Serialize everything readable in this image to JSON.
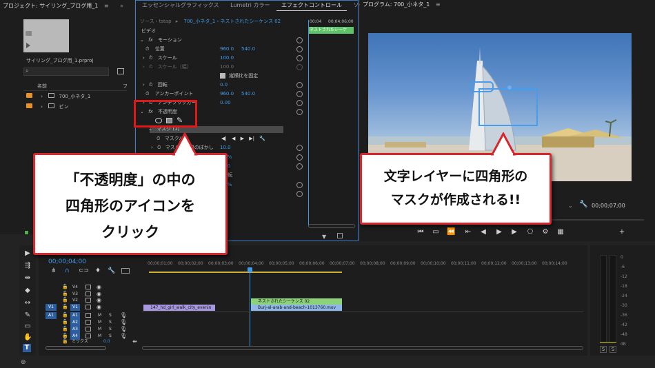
{
  "project_panel": {
    "title": "プロジェクト: サイリング_ブログ用_1",
    "filename": "サイリング_ブログ用_1.prproj",
    "col_name": "名前",
    "col_frame": "フ",
    "items": [
      {
        "label": "700_小ネタ_1"
      },
      {
        "label": "ビン"
      }
    ]
  },
  "effect_panel": {
    "tabs": [
      "エッセンシャルグラフィックス",
      "Lumetri カラー",
      "エフェクトコントロール",
      "ソー"
    ],
    "source": "ソース・tstap",
    "sequence": "700_小ネタ_1・ネストされたシーケンス 02",
    "ruler_left": "00:04",
    "ruler_right": "00;04;06;00",
    "clip_label": "ネストされたシーケ",
    "section_video": "ビデオ",
    "motion": "モーション",
    "position": {
      "label": "位置",
      "x": "960.0",
      "y": "540.0"
    },
    "scale": {
      "label": "スケール",
      "value": "100.0"
    },
    "scale_width": {
      "label": "スケール（幅）",
      "value": "100.0"
    },
    "uniform_scale": "縦横比を固定",
    "rotation": {
      "label": "回転",
      "value": "0.0"
    },
    "anchor": {
      "label": "アンカーポイント",
      "x": "960.0",
      "y": "540.0"
    },
    "antiflicker": {
      "label": "アンチフリッカー",
      "value": "0.00"
    },
    "opacity": "不透明度",
    "mask": "マスク (1)",
    "mask_path": "マスクパス",
    "mask_feather": {
      "label": "マスクの境界のぼかし",
      "value": "10.0"
    },
    "mask_opacity_value": "0 %",
    "mask_expansion_value": "0.0",
    "invert": "反転",
    "opacity_value": "0 %",
    "blend": "常"
  },
  "program_panel": {
    "title": "プログラム: 700_小ネタ_1",
    "timecode": "00;00;07;00"
  },
  "timeline": {
    "timecode": "00;00;04;00",
    "ruler": [
      "00;00;01;00",
      "00;00;02;00",
      "00;00;03;00",
      "00;00;04;00",
      "00;00;05;00",
      "00;00;06;00",
      "00;00;07;00",
      "00;00;08;00",
      "00;00;09;00",
      "00;00;10;00",
      "00;00;11;00",
      "00;00;12;00",
      "00;00;13;00",
      "00;00;14;00"
    ],
    "tracks_video": [
      "V4",
      "V3",
      "V2",
      "V1"
    ],
    "tracks_audio": [
      "A1",
      "A2",
      "A3",
      "A4"
    ],
    "src_v": "V1",
    "src_a": "A1",
    "mix_label": "ミックス",
    "mix_value": "0.0",
    "clip_nested": "ネストされたシーケンス 02",
    "clip_girl": "147_hd_girl_walk_city_evenin",
    "clip_burj": "Burj-al-arab-and-beach-1013760.mov",
    "m_label": "M",
    "s_label": "S"
  },
  "meter": {
    "labels": [
      "0",
      "-6",
      "-12",
      "-18",
      "-24",
      "-30",
      "-36",
      "-42",
      "-48",
      "dB"
    ],
    "solo": "S"
  },
  "callouts": {
    "left": [
      "「不透明度」の中の",
      "四角形のアイコンを",
      "クリック"
    ],
    "right": [
      "文字レイヤーに四角形の",
      "マスクが作成される!!"
    ]
  },
  "colors": {
    "accent_blue": "#3f9ae5",
    "callout_red": "#d7262c",
    "clip_green": "#8cd27a",
    "clip_purple": "#a898e0",
    "clip_blue": "#8fb8e8"
  }
}
